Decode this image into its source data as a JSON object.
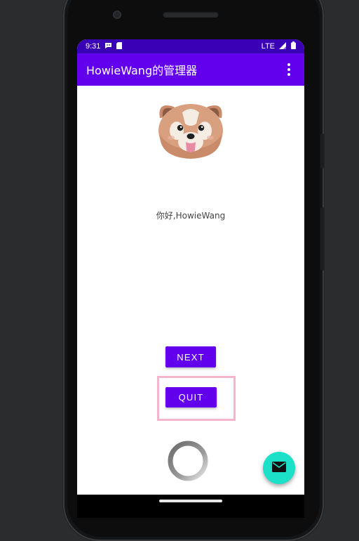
{
  "status_bar": {
    "time": "9:31",
    "network": "LTE",
    "left_icons": [
      "messaging-icon",
      "sd-card-icon"
    ],
    "right_icons": [
      "signal-icon",
      "battery-icon"
    ]
  },
  "app_bar": {
    "title": "HowieWang的管理器",
    "overflow_icon": "more-vert-icon"
  },
  "content": {
    "avatar_icon": "red-panda-icon",
    "greeting": "你好,HowieWang"
  },
  "buttons": {
    "next_label": "NEXT",
    "quit_label": "QUIT"
  },
  "fab": {
    "icon": "mail-icon"
  },
  "colors": {
    "primary": "#6200ee",
    "primary_dark": "#3a00b5",
    "fab": "#1de0c8",
    "highlight": "#f3b6cc"
  }
}
